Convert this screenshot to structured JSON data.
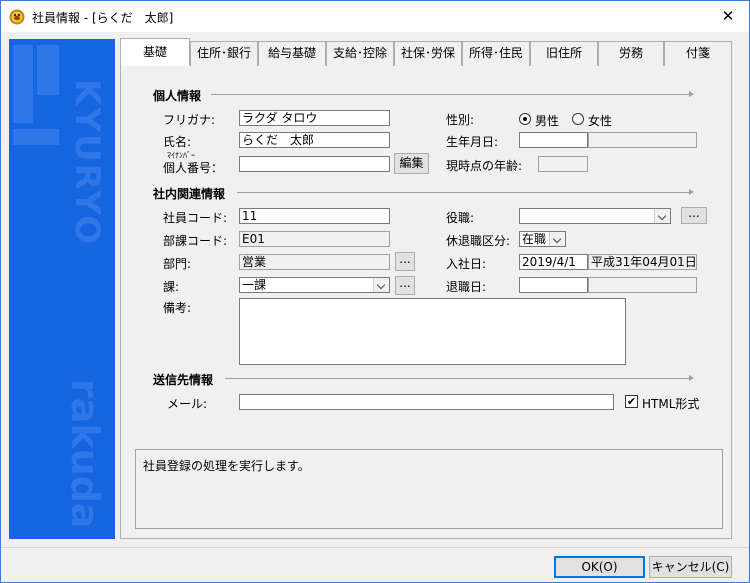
{
  "window": {
    "title": "社員情報 - [らくだ　太郎]",
    "close_glyph": "✕"
  },
  "sidebar": {
    "watermark_top": "KYURYO",
    "watermark_bottom": "rakuda"
  },
  "tabs": [
    {
      "label": "基礎",
      "active": true
    },
    {
      "label": "住所･銀行",
      "active": false
    },
    {
      "label": "給与基礎",
      "active": false
    },
    {
      "label": "支給･控除",
      "active": false
    },
    {
      "label": "社保･労保",
      "active": false
    },
    {
      "label": "所得･住民",
      "active": false
    },
    {
      "label": "旧住所",
      "active": false
    },
    {
      "label": "労務",
      "active": false
    },
    {
      "label": "付箋",
      "active": false
    }
  ],
  "personal": {
    "section_title": "個人情報",
    "furigana_label": "フリガナ:",
    "furigana_value": "ラクダ タロウ",
    "name_label": "氏名:",
    "name_value": "らくだ　太郎",
    "mynumber_label_top": "ﾏｲﾅﾝﾊﾞｰ",
    "mynumber_label": "個人番号：",
    "mynumber_value": "",
    "edit_button": "編集",
    "gender_label": "性別:",
    "gender_male": "男性",
    "gender_female": "女性",
    "gender_selected": "male",
    "birth_label": "生年月日:",
    "birth_value": "",
    "birth_era_value": "",
    "age_label": "現時点の年齢:",
    "age_value": ""
  },
  "company": {
    "section_title": "社内関連情報",
    "code_label": "社員コード:",
    "code_value": "11",
    "dept_code_label": "部課コード:",
    "dept_code_value": "E01",
    "dept_label": "部門:",
    "dept_value": "営業",
    "section_label": "課:",
    "section_value": "一課",
    "note_label": "備考:",
    "note_value": "",
    "position_label": "役職:",
    "position_value": "",
    "leave_label": "休退職区分:",
    "leave_value": "在職",
    "join_label": "入社日:",
    "join_value": "2019/4/1",
    "join_era_value": "平成31年04月01日",
    "retire_label": "退職日:",
    "retire_value": "",
    "retire_era_value": "",
    "browse_button": "..."
  },
  "send": {
    "section_title": "送信先情報",
    "mail_label": "メール:",
    "mail_value": "",
    "html_label": "HTML形式",
    "html_checked": true,
    "check_glyph": "✔"
  },
  "status": {
    "message": "社員登録の処理を実行します。"
  },
  "footer": {
    "ok_button": "OK(O)",
    "cancel_button": "キャンセル(C)"
  }
}
